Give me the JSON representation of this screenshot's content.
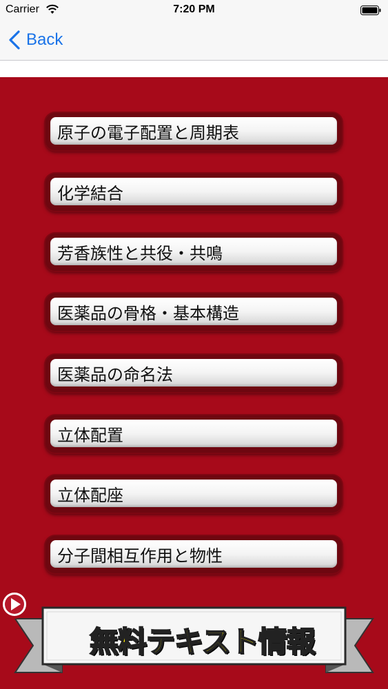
{
  "status_bar": {
    "carrier": "Carrier",
    "time": "7:20 PM"
  },
  "nav": {
    "back_label": "Back"
  },
  "menu": {
    "items": [
      {
        "label": "原子の電子配置と周期表"
      },
      {
        "label": "化学結合"
      },
      {
        "label": "芳香族性と共役・共鳴"
      },
      {
        "label": "医薬品の骨格・基本構造"
      },
      {
        "label": "医薬品の命名法"
      },
      {
        "label": "立体配置"
      },
      {
        "label": "立体配座"
      },
      {
        "label": "分子間相互作用と物性"
      }
    ]
  },
  "banner": {
    "text": "無料テキスト情報",
    "icon": "play-icon"
  },
  "colors": {
    "background_red": "#a70a1a",
    "nav_tint": "#1a73e8",
    "banner_text": "#ffee00"
  }
}
